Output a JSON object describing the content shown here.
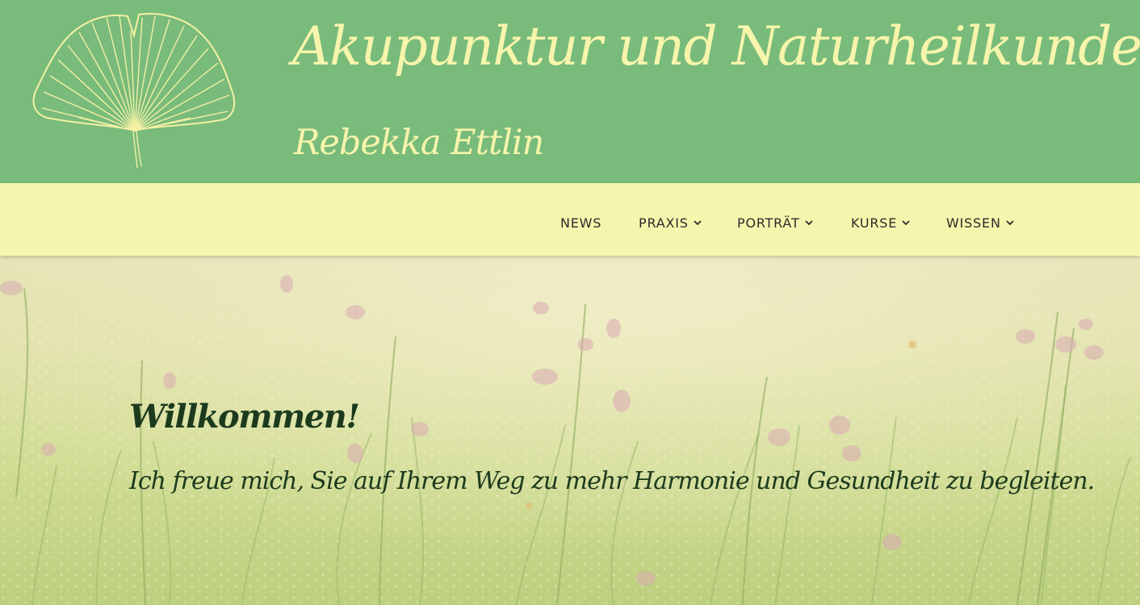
{
  "header": {
    "title": "Akupunktur und Naturheilkunde",
    "subtitle": "Rebekka Ettlin",
    "logo_icon": "ginkgo-leaf-icon",
    "background_color": "#79bb7b",
    "text_color": "#f6f5ab"
  },
  "nav": {
    "background_color": "#f6f5ad",
    "items": [
      {
        "label": "NEWS",
        "has_dropdown": false
      },
      {
        "label": "PRAXIS",
        "has_dropdown": true,
        "icon": "chevron-down-icon"
      },
      {
        "label": "PORTRÄT",
        "has_dropdown": true,
        "icon": "chevron-down-icon"
      },
      {
        "label": "KURSE",
        "has_dropdown": true,
        "icon": "chevron-down-icon"
      },
      {
        "label": "WISSEN",
        "has_dropdown": true,
        "icon": "chevron-down-icon"
      }
    ]
  },
  "hero": {
    "heading": "Willkommen!",
    "text": "Ich freue mich, Sie auf Ihrem Weg zu mehr Harmonie und Gesundheit zu begleiten.",
    "background": "meadow-with-flowers-image",
    "text_color": "#1c3a1d"
  }
}
